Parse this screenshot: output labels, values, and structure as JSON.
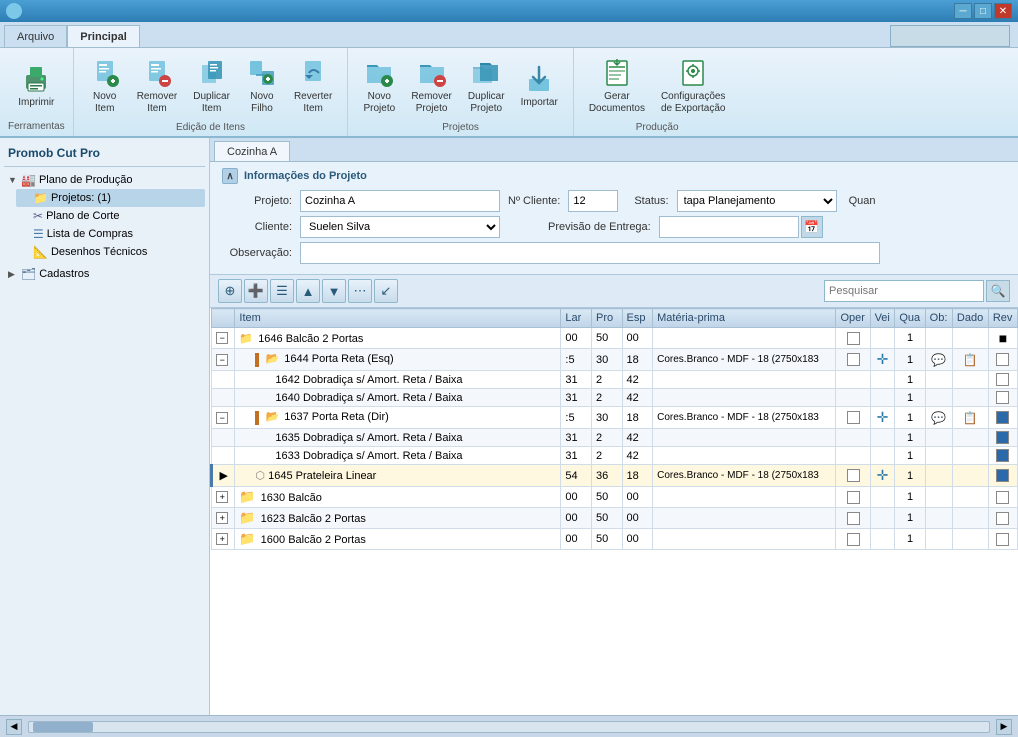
{
  "titleBar": {
    "appIcon": "●",
    "controls": [
      "─",
      "□",
      "✕"
    ]
  },
  "ribbonTabs": [
    {
      "label": "Arquivo",
      "active": false
    },
    {
      "label": "Principal",
      "active": true
    }
  ],
  "ribbonSections": [
    {
      "name": "Ferramentas",
      "buttons": [
        {
          "label": "Imprimir",
          "icon": "🖨",
          "iconClass": "icon-print"
        }
      ]
    },
    {
      "name": "Edição de Itens",
      "buttons": [
        {
          "label": "Novo\nItem",
          "icon": "📄+",
          "iconClass": "icon-new-item"
        },
        {
          "label": "Remover\nItem",
          "icon": "📄-",
          "iconClass": "icon-remove"
        },
        {
          "label": "Duplicar\nItem",
          "icon": "📄📄",
          "iconClass": "icon-duplicate"
        },
        {
          "label": "Novo\nFilho",
          "icon": "📋+",
          "iconClass": "icon-new-child"
        },
        {
          "label": "Reverter\nItem",
          "icon": "↩",
          "iconClass": "icon-revert"
        }
      ]
    },
    {
      "name": "Projetos",
      "buttons": [
        {
          "label": "Novo\nProjeto",
          "icon": "📁+",
          "iconClass": "icon-project"
        },
        {
          "label": "Remover\nProjeto",
          "icon": "📁-",
          "iconClass": "icon-project"
        },
        {
          "label": "Duplicar\nProjeto",
          "icon": "📁📁",
          "iconClass": "icon-project"
        },
        {
          "label": "Importar",
          "icon": "📥",
          "iconClass": "icon-project"
        }
      ]
    },
    {
      "name": "Produção",
      "buttons": [
        {
          "label": "Gerar\nDocumentos",
          "icon": "📊",
          "iconClass": "icon-produce"
        },
        {
          "label": "Configurações\nde Exportação",
          "icon": "⚙",
          "iconClass": "icon-settings"
        }
      ]
    }
  ],
  "statusInput": "",
  "sidebar": {
    "title": "Promob Cut Pro",
    "tree": [
      {
        "label": "Plano de Produção",
        "icon": "🏭",
        "indent": 0,
        "hasArrow": true,
        "arrowOpen": true
      },
      {
        "label": "Projetos: (1)",
        "icon": "📁",
        "indent": 1,
        "hasArrow": false,
        "selected": true
      },
      {
        "label": "Plano de Corte",
        "icon": "✂",
        "indent": 1,
        "hasArrow": false
      },
      {
        "label": "Lista de Compras",
        "icon": "📋",
        "indent": 1,
        "hasArrow": false
      },
      {
        "label": "Desenhos Técnicos",
        "icon": "📐",
        "indent": 1,
        "hasArrow": false
      },
      {
        "label": "Cadastros",
        "icon": "🗂",
        "indent": 0,
        "hasArrow": true,
        "arrowOpen": false
      }
    ]
  },
  "contentTab": "Cozinha A",
  "projectInfo": {
    "sectionTitle": "Informações do Projeto",
    "fields": {
      "projeto_label": "Projeto:",
      "projeto_value": "Cozinha A",
      "noCliente_label": "Nº Cliente:",
      "noCliente_value": "12",
      "status_label": "Status:",
      "status_value": "tapa Planejamento",
      "quan_label": "Quan",
      "cliente_label": "Cliente:",
      "cliente_value": "Suelen Silva",
      "previsaoEntrega_label": "Previsão de Entrega:",
      "observacao_label": "Observação:"
    }
  },
  "toolbar": {
    "buttons": [
      "⊕",
      "➕",
      "☰",
      "▲",
      "▼",
      "⋯",
      "↙"
    ],
    "searchPlaceholder": "Pesquisar"
  },
  "table": {
    "headers": [
      "",
      "Item",
      "Lar",
      "Pro",
      "Esp",
      "Matéria-prima",
      "Oper",
      "Vei",
      "Qua",
      "Ob:",
      "Dado",
      "Rev"
    ],
    "rows": [
      {
        "indent": 0,
        "expandable": true,
        "expanded": true,
        "icon": "folder",
        "id": "1646",
        "name": "Balcão 2 Portas",
        "lar": "00",
        "pro": "50",
        "esp": "00",
        "materia": "",
        "hasOper": true,
        "hasVei": false,
        "qua": "1",
        "ob": "",
        "dado": "",
        "rev": "■",
        "selected": false,
        "highlight": false
      },
      {
        "indent": 1,
        "expandable": true,
        "expanded": true,
        "icon": "folder-small",
        "id": "1644",
        "name": "Porta Reta (Esq)",
        "lar": ":5",
        "pro": "30",
        "esp": "18",
        "materia": "Cores.Branco - MDF - 18 (2750x183",
        "hasOper": true,
        "hasMove": true,
        "qua": "1",
        "ob": "💬",
        "dado": "📋",
        "rev": "",
        "selected": false,
        "highlight": false
      },
      {
        "indent": 2,
        "expandable": false,
        "icon": "none",
        "id": "1642",
        "name": "Dobradiça s/ Amort. Reta / Baixa",
        "lar": "31",
        "pro": "2",
        "esp": "42",
        "materia": "",
        "hasOper": false,
        "qua": "1",
        "ob": "",
        "dado": "",
        "rev": "",
        "selected": false,
        "highlight": false
      },
      {
        "indent": 2,
        "expandable": false,
        "icon": "none",
        "id": "1640",
        "name": "Dobradiça s/ Amort. Reta / Baixa",
        "lar": "31",
        "pro": "2",
        "esp": "42",
        "materia": "",
        "hasOper": false,
        "qua": "1",
        "ob": "",
        "dado": "",
        "rev": "",
        "selected": false,
        "highlight": false
      },
      {
        "indent": 1,
        "expandable": true,
        "expanded": true,
        "icon": "folder-small",
        "id": "1637",
        "name": "Porta Reta (Dir)",
        "lar": ":5",
        "pro": "30",
        "esp": "18",
        "materia": "Cores.Branco - MDF - 18 (2750x183",
        "hasOper": true,
        "hasMove": true,
        "qua": "1",
        "ob": "💬",
        "dado": "📋",
        "rev": "☑",
        "selected": false,
        "highlight": false
      },
      {
        "indent": 2,
        "expandable": false,
        "icon": "none",
        "id": "1635",
        "name": "Dobradiça s/ Amort. Reta / Baixa",
        "lar": "31",
        "pro": "2",
        "esp": "42",
        "materia": "",
        "hasOper": false,
        "qua": "1",
        "ob": "",
        "dado": "",
        "rev": "☑",
        "selected": false,
        "highlight": false
      },
      {
        "indent": 2,
        "expandable": false,
        "icon": "none",
        "id": "1633",
        "name": "Dobradiça s/ Amort. Reta / Baixa",
        "lar": "31",
        "pro": "2",
        "esp": "42",
        "materia": "",
        "hasOper": false,
        "qua": "1",
        "ob": "",
        "dado": "",
        "rev": "☑",
        "selected": false,
        "highlight": false
      },
      {
        "indent": 1,
        "expandable": false,
        "icon": "shelf",
        "id": "1645",
        "name": "Prateleira Linear",
        "lar": "54",
        "pro": "36",
        "esp": "18",
        "materia": "Cores.Branco - MDF - 18 (2750x183",
        "hasOper": true,
        "hasMove": true,
        "qua": "1",
        "ob": "",
        "dado": "",
        "rev": "☑",
        "selected": true,
        "highlight": true
      },
      {
        "indent": 0,
        "expandable": true,
        "expanded": false,
        "icon": "folder-gray",
        "id": "1630",
        "name": "Balcão",
        "lar": "00",
        "pro": "50",
        "esp": "00",
        "materia": "",
        "hasOper": true,
        "qua": "1",
        "ob": "",
        "dado": "",
        "rev": "",
        "selected": false,
        "highlight": false
      },
      {
        "indent": 0,
        "expandable": true,
        "expanded": false,
        "icon": "folder",
        "id": "1623",
        "name": "Balcão 2 Portas",
        "lar": "00",
        "pro": "50",
        "esp": "00",
        "materia": "",
        "hasOper": true,
        "qua": "1",
        "ob": "",
        "dado": "",
        "rev": "",
        "selected": false,
        "highlight": false
      },
      {
        "indent": 0,
        "expandable": true,
        "expanded": false,
        "icon": "folder",
        "id": "1600",
        "name": "Balcão 2 Portas",
        "lar": "00",
        "pro": "50",
        "esp": "00",
        "materia": "",
        "hasOper": true,
        "qua": "1",
        "ob": "",
        "dado": "",
        "rev": "",
        "selected": false,
        "highlight": false
      }
    ]
  }
}
